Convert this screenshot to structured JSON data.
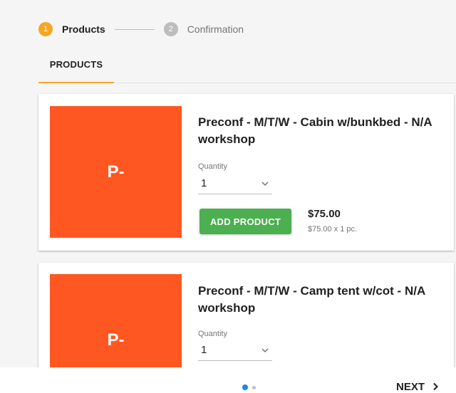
{
  "stepper": {
    "steps": [
      {
        "number": "1",
        "label": "Products",
        "state": "active"
      },
      {
        "number": "2",
        "label": "Confirmation",
        "state": "inactive"
      }
    ]
  },
  "tabs": [
    {
      "label": "PRODUCTS",
      "selected": true
    }
  ],
  "products": [
    {
      "thumb_text": "P-",
      "title": "Preconf - M/T/W - Cabin w/bunkbed - N/A workshop",
      "quantity_label": "Quantity",
      "quantity_value": "1",
      "add_label": "ADD PRODUCT",
      "price": "$75.00",
      "price_detail": "$75.00 x 1 pc."
    },
    {
      "thumb_text": "P-",
      "title": "Preconf - M/T/W - Camp tent w/cot - N/A workshop",
      "quantity_label": "Quantity",
      "quantity_value": "1"
    }
  ],
  "pagination": {
    "current_page": 1,
    "total_pages": 2
  },
  "footer": {
    "next_label": "NEXT"
  },
  "colors": {
    "accent": "#f5a623",
    "thumb": "#ff5722",
    "add_button": "#4caf50",
    "active_dot": "#1e88e5"
  },
  "icons": {
    "quantity_dropdown": "chevron-down-icon",
    "next": "chevron-right-icon"
  }
}
